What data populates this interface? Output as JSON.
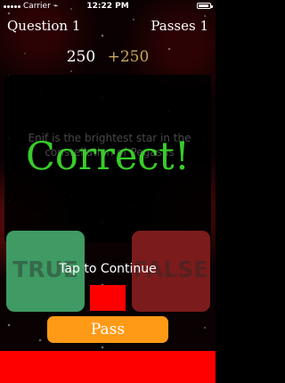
{
  "status_bar": {
    "carrier": "Carrier",
    "time": "12:22 PM"
  },
  "header": {
    "question_label": "Question 1",
    "passes_label": "Passes 1"
  },
  "score": {
    "current": "250",
    "bonus": "+250"
  },
  "question": {
    "text": "Enif is the brightest star in the constellation of Pegasus"
  },
  "result": {
    "text": "Correct!"
  },
  "answers": {
    "true_label": "TRUE",
    "false_label": "FALSE"
  },
  "continue_text": "Tap to Continue",
  "pass_button": "Pass",
  "colors": {
    "correct": "#39cc2a",
    "true": "#3f9a63",
    "false": "#7b1b1b",
    "pass": "#ff9a17",
    "alert": "#ff0000"
  },
  "icons": {
    "wifi": "wifi-icon",
    "battery": "battery-icon"
  }
}
